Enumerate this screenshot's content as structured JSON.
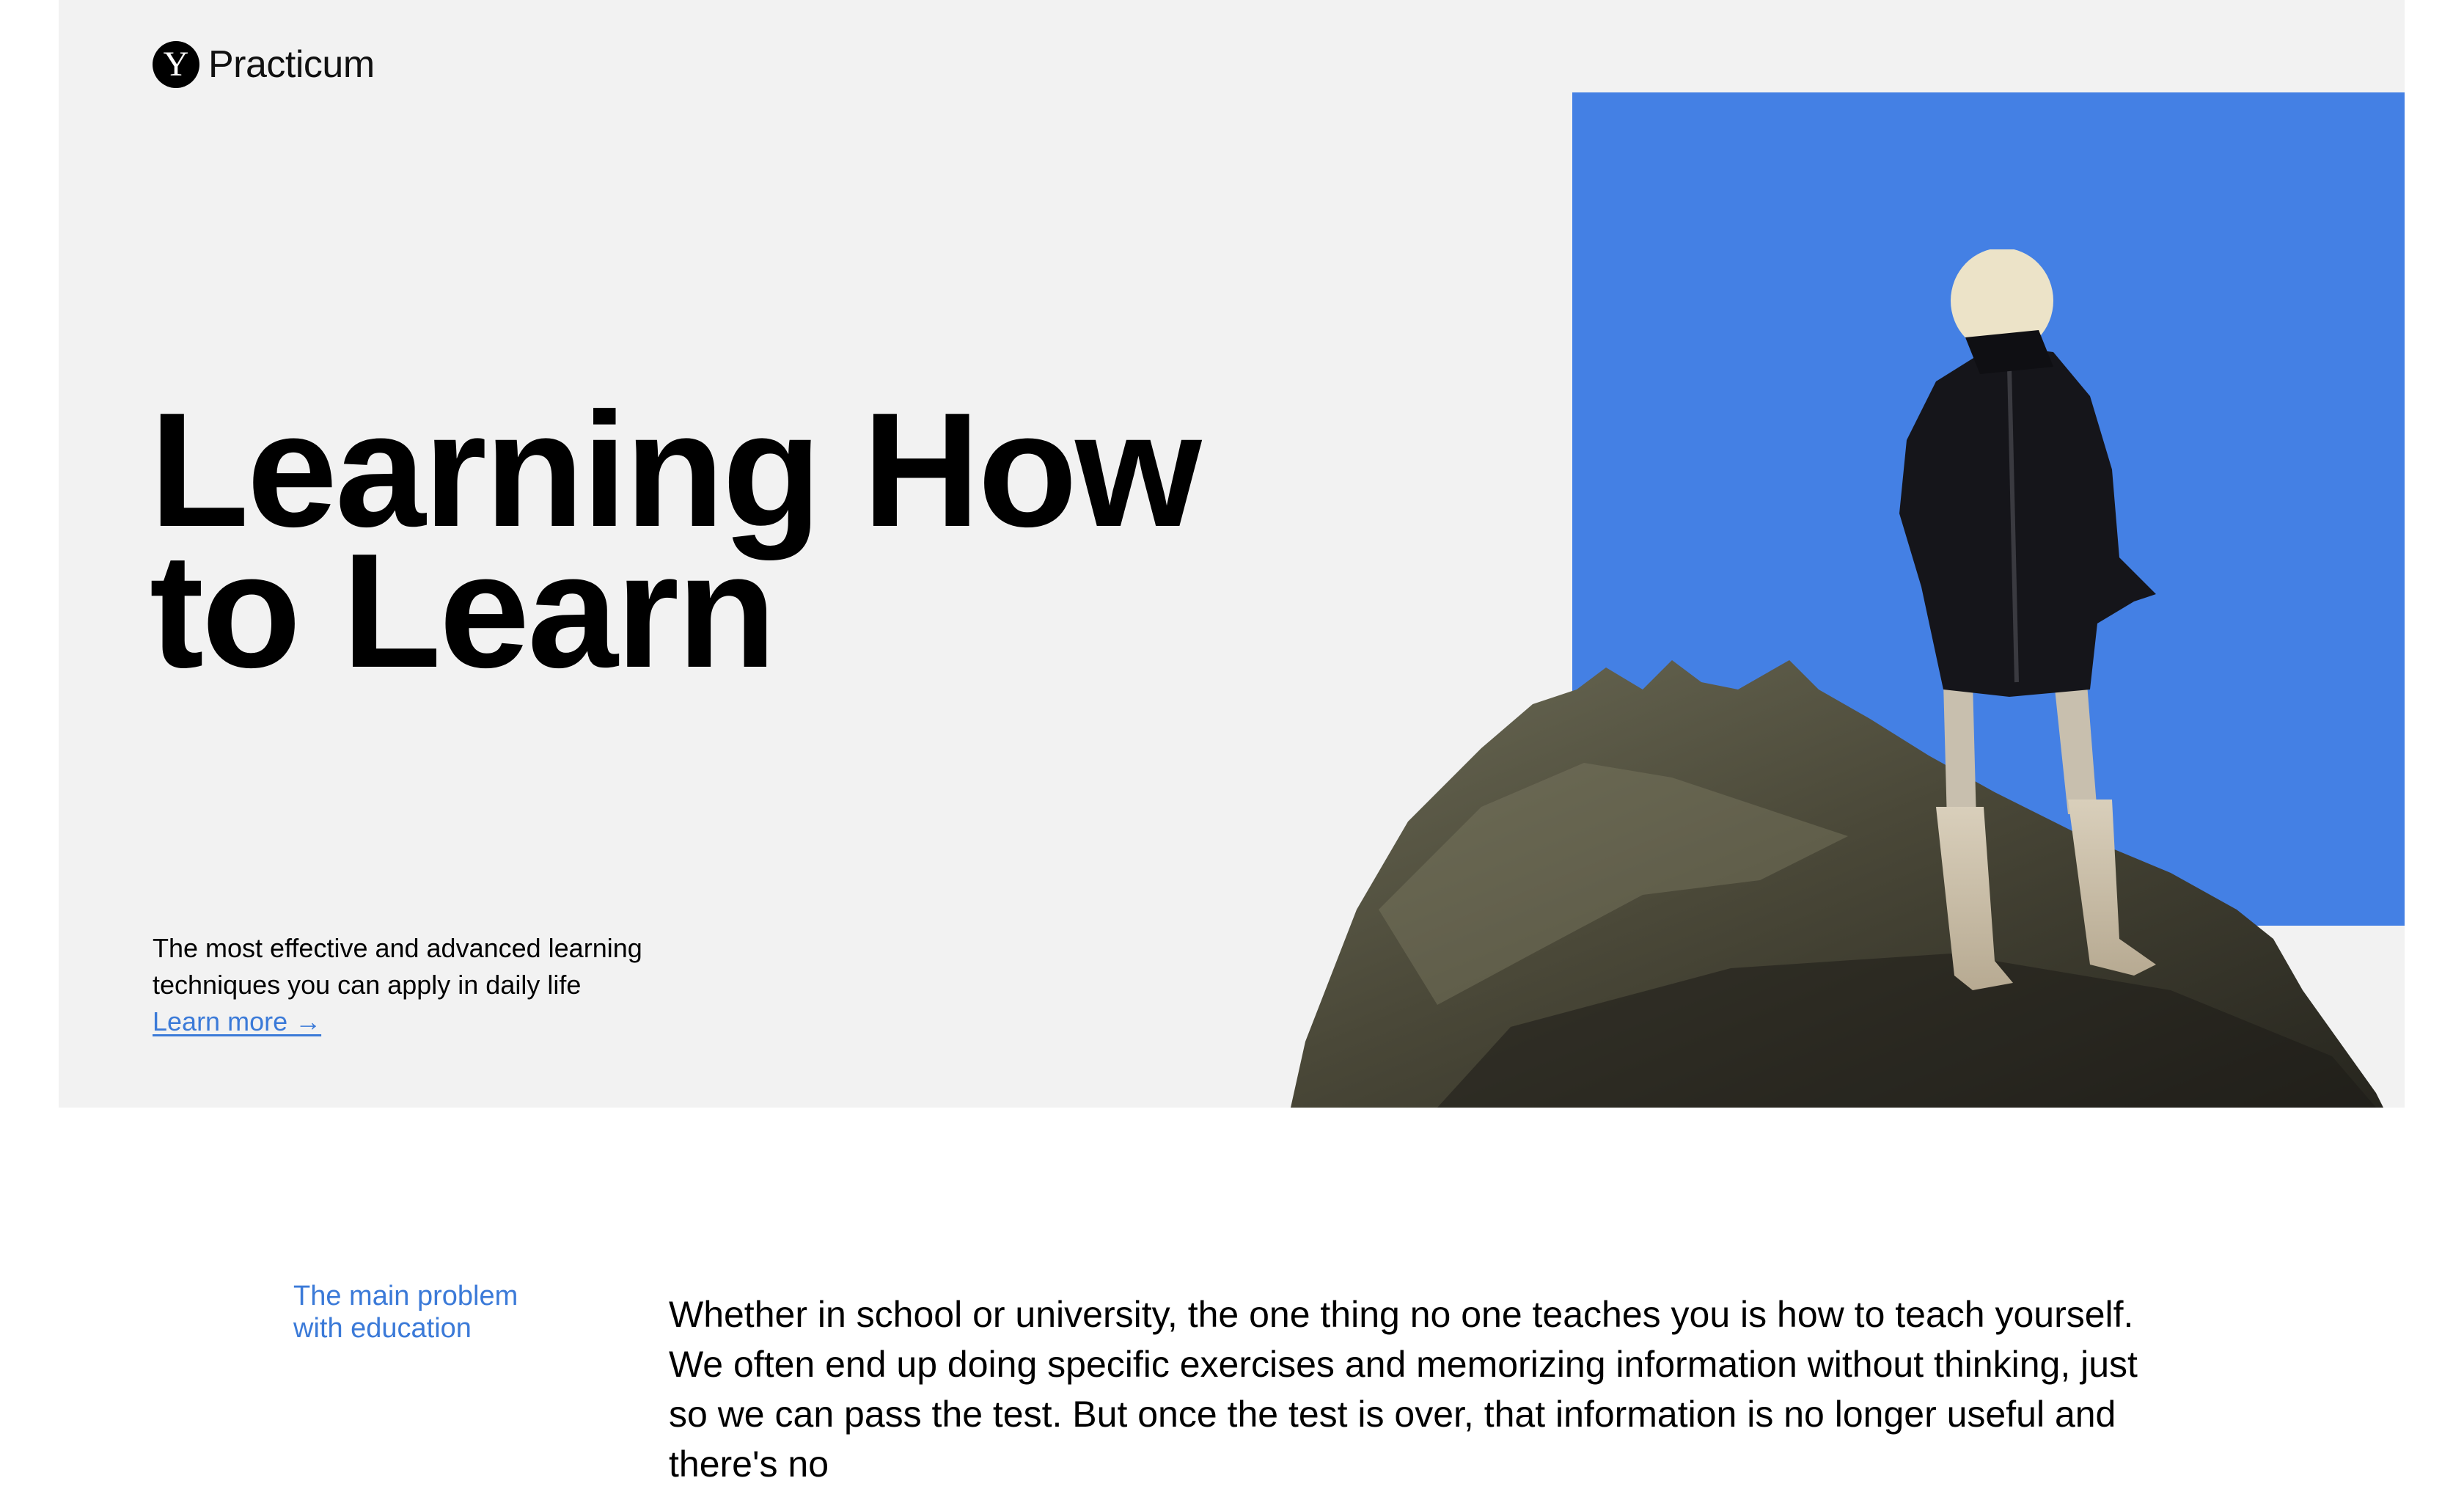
{
  "header": {
    "logo_mark": "Y",
    "logo_text": "Practicum"
  },
  "hero": {
    "title_line1": "Learning How",
    "title_line2": "to Learn",
    "subtitle_line1": "The most effective and advanced learning",
    "subtitle_line2": "techniques you can apply in daily life",
    "cta_label": "Learn more →"
  },
  "section": {
    "label_line1": "The main problem",
    "label_line2": "with education",
    "body": "Whether in school or university, the one thing no one teaches you is how to teach yourself. We often end up doing specific exercises and memorizing information without thinking, just so we can pass the test. But once the test is over, that information is no longer useful and there's no"
  },
  "colors": {
    "hero_bg": "#f2f2f2",
    "accent_blue": "#4480e4",
    "link_blue": "#3b7ad8"
  },
  "icons": {
    "logo": "yandex-y-logo-icon"
  }
}
